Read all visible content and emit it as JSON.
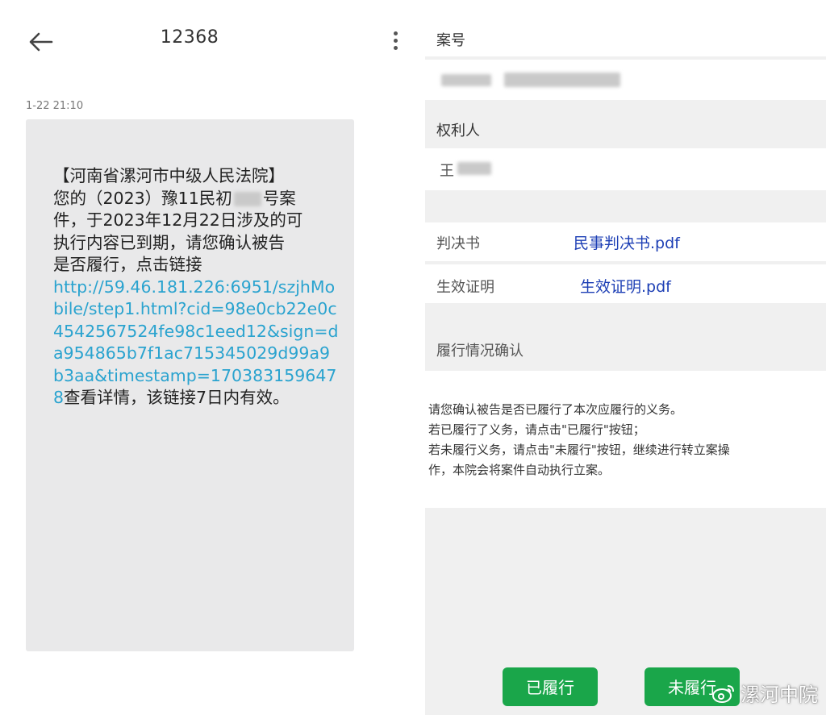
{
  "sms": {
    "title": "12368",
    "timestamp": "1-22 21:10",
    "message": {
      "line1": "【河南省漯河市中级人民法院】",
      "line2a": "您的（2023）豫11民初",
      "line2b": "号案",
      "line3": "件，于2023年12月22日涉及的可",
      "line4": "执行内容已到期，请您确认被告",
      "line5": "是否履行，点击链接",
      "link": "http://59.46.181.226:6951/szjhMobile/step1.html?cid=98e0cb22e0c4542567524fe98c1eed12&sign=da954865b7f1ac715345029d99a9b3aa&timestamp=1703831596478",
      "tail": "查看详情，该链接7日内有效。"
    }
  },
  "page": {
    "case_no_label": "案号",
    "claimant_label": "权利人",
    "claimant_value": "王",
    "judgment_label": "判决书",
    "judgment_file": "民事判决书.pdf",
    "effective_label": "生效证明",
    "effective_file": "生效证明.pdf",
    "confirm_title": "履行情况确认",
    "notice": {
      "line1": "请您确认被告是否已履行了本次应履行的义务。",
      "line2": "若已履行了义务，请点击\"已履行\"按钮；",
      "line3": "若未履行义务，请点击\"未履行\"按钮，继续进行转立案操",
      "line4": "作，本院会将案件自动执行立案。"
    },
    "btn_done": "已履行",
    "btn_not_done": "未履行"
  },
  "watermark": "漯河中院",
  "colors": {
    "link": "#2aa3cf",
    "file_link": "#1d3fb5",
    "button": "#1aa64a"
  }
}
